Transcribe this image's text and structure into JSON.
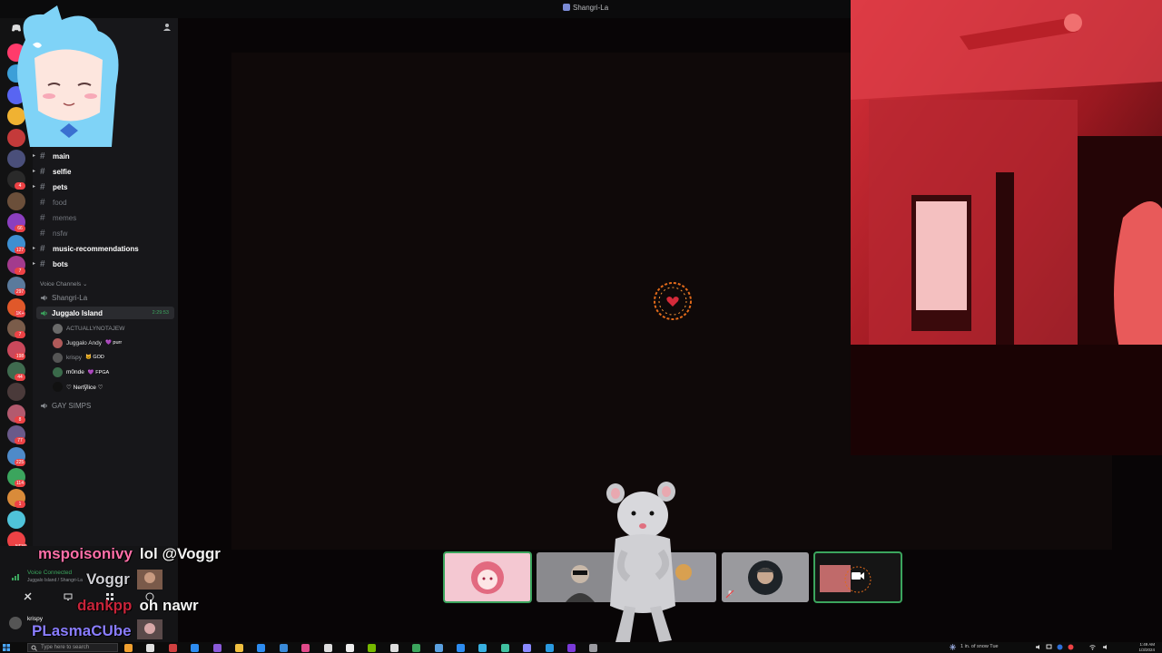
{
  "window": {
    "title": "Shangri-La"
  },
  "servers": [
    {
      "color": "#ff3b6b",
      "badge": ""
    },
    {
      "color": "#3c9fd8",
      "badge": ""
    },
    {
      "color": "#5865f2",
      "badge": ""
    },
    {
      "color": "#f0b232",
      "badge": ""
    },
    {
      "color": "#c43a3a",
      "badge": ""
    },
    {
      "color": "#4a4f7a",
      "badge": ""
    },
    {
      "color": "#2a2a2a",
      "badge": "4"
    },
    {
      "color": "#6b4f3a",
      "badge": ""
    },
    {
      "color": "#8b3fbf",
      "badge": "66"
    },
    {
      "color": "#3d8fd1",
      "badge": "127"
    },
    {
      "color": "#a33b8d",
      "badge": "7"
    },
    {
      "color": "#5a7a9c",
      "badge": "297"
    },
    {
      "color": "#e0582a",
      "badge": "1K+"
    },
    {
      "color": "#7a5c4a",
      "badge": "7"
    },
    {
      "color": "#c9485b",
      "badge": "198"
    },
    {
      "color": "#3f6b4f",
      "badge": "44"
    },
    {
      "color": "#4a3a3a",
      "badge": ""
    },
    {
      "color": "#b35a6e",
      "badge": "8"
    },
    {
      "color": "#6a5a8a",
      "badge": "77"
    },
    {
      "color": "#4e8ac9",
      "badge": "225"
    },
    {
      "color": "#3ba55d",
      "badge": "114"
    },
    {
      "color": "#d98b3a",
      "badge": "1"
    },
    {
      "color": "#4fc3d9",
      "badge": ""
    },
    {
      "color": "#ed4245",
      "badge": "NEW"
    }
  ],
  "channels": [
    {
      "name": "main",
      "style": "bold"
    },
    {
      "name": "selfie",
      "style": "bold"
    },
    {
      "name": "pets",
      "style": "bold"
    },
    {
      "name": "food",
      "style": "muted"
    },
    {
      "name": "memes",
      "style": "muted"
    },
    {
      "name": "nsfw",
      "style": "muted"
    },
    {
      "name": "music-recommendations",
      "style": "bold"
    },
    {
      "name": "bots",
      "style": "bold"
    }
  ],
  "voice": {
    "header": "Voice Channels",
    "channels": [
      {
        "name": "Shangri-La"
      },
      {
        "name": "Juggalo Island",
        "timer": "2:29:53"
      },
      {
        "name": "GAY SIMPS"
      }
    ],
    "members": [
      {
        "name": "ACTUALLYNOTAJEW",
        "tag": "",
        "color": "#8e9297",
        "avatar": "#6a6a6a"
      },
      {
        "name": "Juggalo Andy",
        "tag": "💜 purr",
        "color": "#dcddde",
        "avatar": "#b05a5a"
      },
      {
        "name": "krispy",
        "tag": "🐱 GOD",
        "color": "#8e9297",
        "avatar": "#555"
      },
      {
        "name": "m0nde",
        "tag": "💜 FPGA",
        "color": "#ffffff",
        "avatar": "#3a6a4a"
      },
      {
        "name": "♡ Nerty̅lice ♡",
        "tag": "",
        "color": "#ffffff",
        "avatar": "#111"
      }
    ]
  },
  "panel": {
    "voice_connected": "Voice Connected",
    "voice_location": "Juggalo Island / Shangri-La",
    "username": "krispy"
  },
  "chat": [
    {
      "user": "mspoisonivy",
      "msg": "lol @Voggr"
    },
    {
      "user": "Voggr",
      "msg": ""
    },
    {
      "user": "dankpp",
      "msg": "oh nawr"
    },
    {
      "user": "PLasmaCUbe",
      "msg": ""
    }
  ],
  "taskbar": {
    "search_placeholder": "Type here to search",
    "weather": "1 in. of snow Tue",
    "time": "1:49 AM",
    "date": "1/3/2024"
  },
  "colors": {
    "speaking": "#3ba55d",
    "stage": "#0f0909",
    "webcam": "#c0202a"
  }
}
